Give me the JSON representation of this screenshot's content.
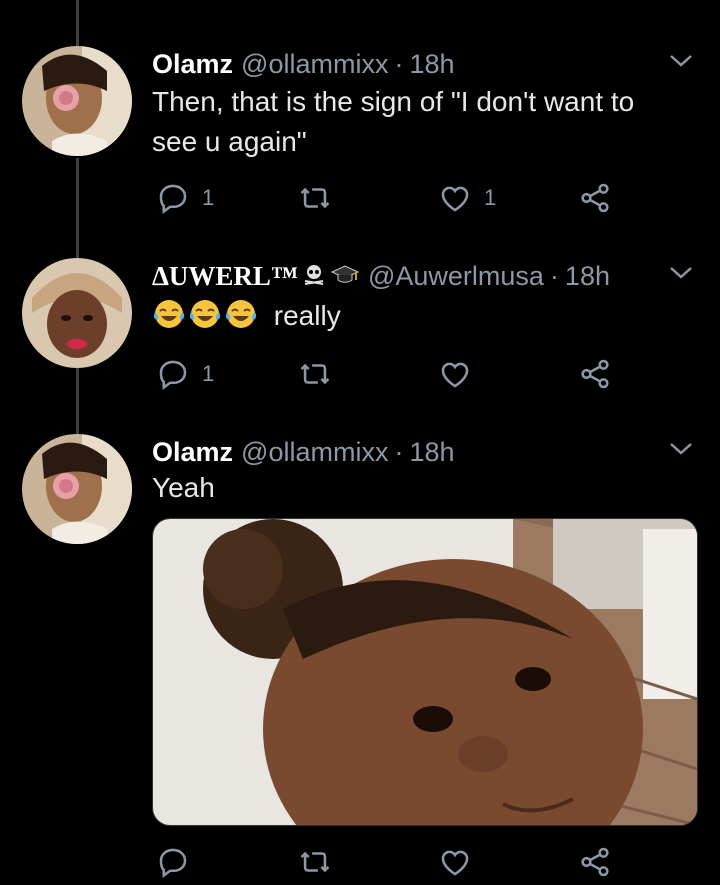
{
  "tweets": [
    {
      "name": "Olamz",
      "handle": "@ollammixx",
      "sep": "·",
      "time": "18h",
      "text": "Then, that is the sign of \"I don't want to see u again\"",
      "reply_count": "1",
      "retweet_count": "",
      "like_count": "1"
    },
    {
      "name": "ΔUWERL™",
      "handle": "@Auwerlmusa",
      "sep": "·",
      "time": "18h",
      "text": "really",
      "reply_count": "1",
      "retweet_count": "",
      "like_count": ""
    },
    {
      "name": "Olamz",
      "handle": "@ollammixx",
      "sep": "·",
      "time": "18h",
      "text": "Yeah",
      "reply_count": "",
      "retweet_count": "",
      "like_count": ""
    }
  ],
  "icons": {
    "reply": "reply-icon",
    "retweet": "retweet-icon",
    "like": "heart-icon",
    "share": "share-icon",
    "menu": "chevron-down-icon",
    "emoji": "tears-of-joy-emoji"
  },
  "colors": {
    "background": "#000000",
    "name": "#ffffff",
    "secondary": "#8b98a5",
    "thread_line": "#3d4145"
  }
}
